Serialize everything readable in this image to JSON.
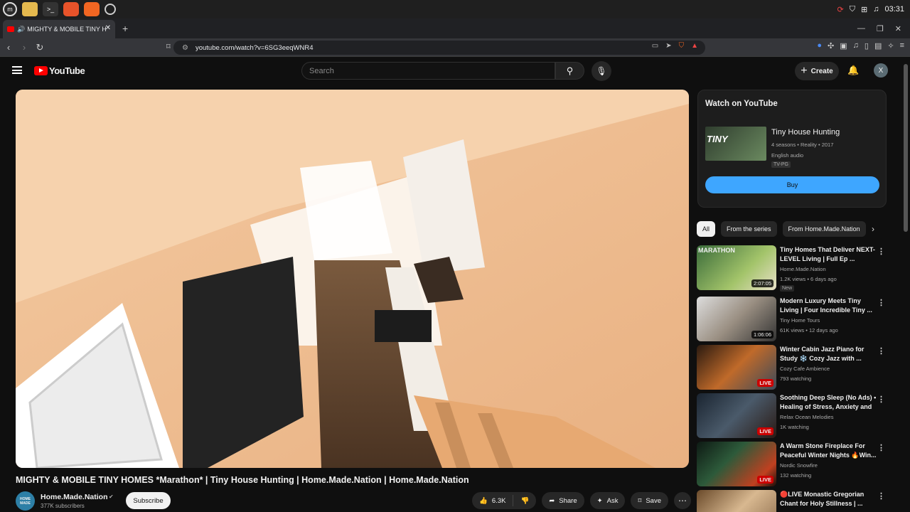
{
  "taskbar": {
    "clock": "03:31"
  },
  "tab": {
    "title": "MIGHTY & MOBILE TINY H"
  },
  "address": {
    "url": "youtube.com/watch?v=6SG3eeqWNR4"
  },
  "header": {
    "logo_text": "YouTube",
    "search_placeholder": "Search",
    "create_label": "Create",
    "avatar_letter": "X"
  },
  "video": {
    "title": "MIGHTY & MOBILE TINY HOMES *Marathon* | Tiny House Hunting | Home.Made.Nation | Home.Made.Nation",
    "channel": "Home.Made.Nation",
    "subscribers": "377K subscribers",
    "subscribe_label": "Subscribe",
    "likes": "6.3K",
    "share_label": "Share",
    "ask_label": "Ask",
    "save_label": "Save"
  },
  "watch_card": {
    "heading": "Watch on YouTube",
    "title": "Tiny House Hunting",
    "meta": "4 seasons • Reality • 2017",
    "audio": "English audio",
    "rating": "TV-PG",
    "buy_label": "Buy"
  },
  "chips": [
    "All",
    "From the series",
    "From Home.Made.Nation"
  ],
  "recommendations": [
    {
      "title": "Tiny Homes That Deliver NEXT-LEVEL Living | Full Ep ...",
      "channel": "Home.Made.Nation",
      "views": "1.2K views • 6 days ago",
      "duration": "2:07:05",
      "badge": "New"
    },
    {
      "title": "Modern Luxury Meets Tiny Living | Four Incredible Tiny ...",
      "channel": "Tiny Home Tours",
      "views": "61K views • 12 days ago",
      "duration": "1:06:06"
    },
    {
      "title": "Winter Cabin Jazz Piano for Study ❄️ Cozy Jazz with ...",
      "channel": "Cozy Cafe Ambience",
      "views": "793 watching",
      "live": "LIVE"
    },
    {
      "title": "Soothing Deep Sleep (No Ads) • Healing of Stress, Anxiety and ...",
      "channel": "Relax Ocean Melodies",
      "views": "1K watching",
      "live": "LIVE"
    },
    {
      "title": "A Warm Stone Fireplace For Peaceful Winter Nights 🔥Win...",
      "channel": "Nordic Snowfire",
      "views": "132 watching",
      "live": "LIVE"
    },
    {
      "title": "🔴LIVE Monastic Gregorian Chant for Holy Stillness | ...",
      "channel": "",
      "views": ""
    }
  ]
}
